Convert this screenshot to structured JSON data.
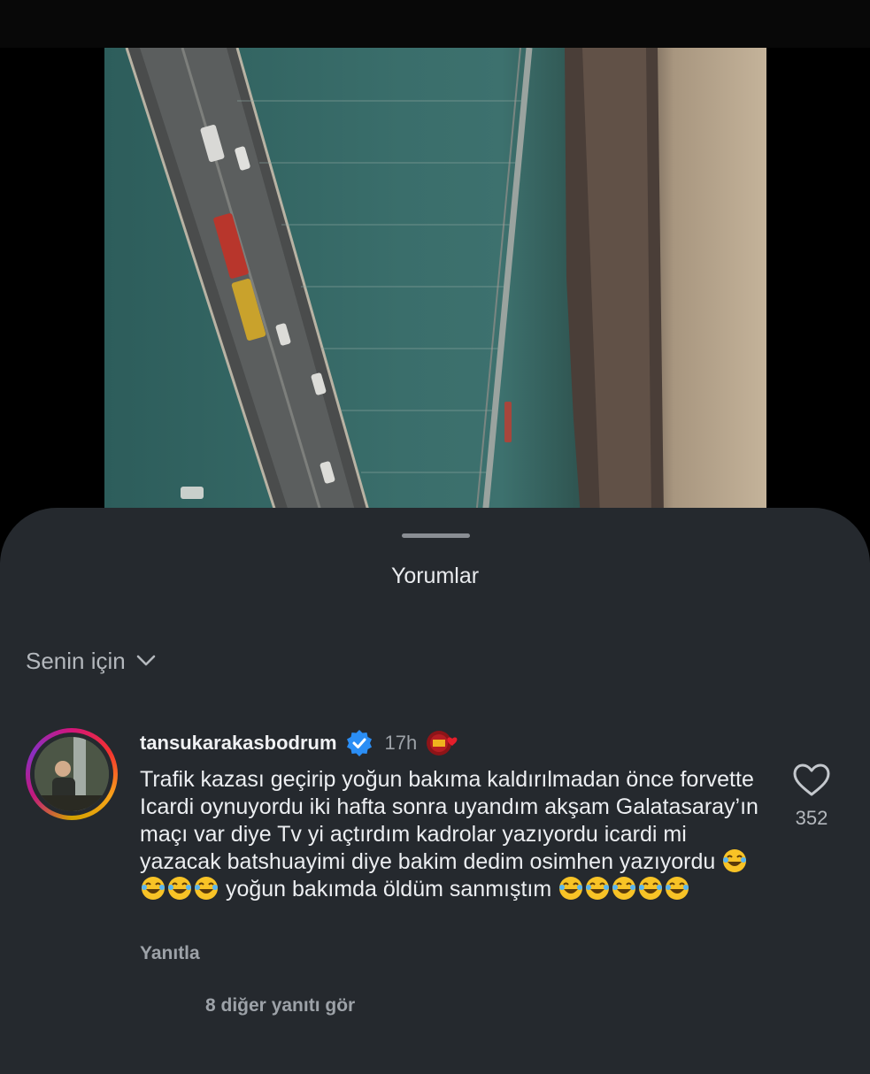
{
  "sheet": {
    "title": "Yorumlar"
  },
  "filter": {
    "label": "Senin için"
  },
  "comment": {
    "username": "tansukarakasbodrum",
    "time": "17h",
    "text_main": "Trafik kazası geçirip yoğun bakıma kaldırılmadan önce forvette Icardi oynuyordu iki hafta sonra uyandım akşam Galatasaray’ın maçı var diye Tv yi açtırdım kadrolar yazıyordu icardi mi yazacak batshuayimi diye bakim dedim osimhen yazıyordu",
    "text_mid": "yoğun bakımda öldüm sanmıştım",
    "likes": "352",
    "reply_label": "Yanıtla",
    "view_replies": "8 diğer yanıtı gör"
  },
  "icons": [
    "chevron-down-icon",
    "verified-badge-icon",
    "galatasaray-heart-badge-icon",
    "heart-icon",
    "laughing-emoji-icon"
  ],
  "colors": {
    "sheet_bg": "#25292e",
    "verified": "#2b8ef5",
    "muted": "#9da2a8"
  }
}
